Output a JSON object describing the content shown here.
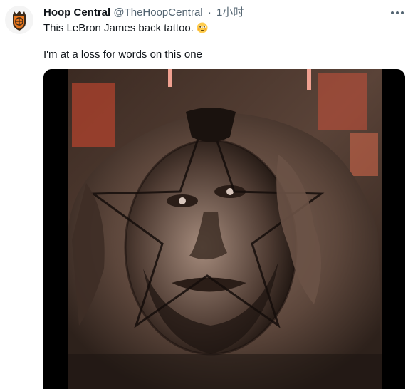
{
  "tweet": {
    "display_name": "Hoop Central",
    "handle": "@TheHoopCentral",
    "separator": "·",
    "time": "1小时",
    "text_line1": "This LeBron James back tattoo.",
    "text_line2": "I'm at a loss for words on this one",
    "emoji": "flushed-face-emoji"
  },
  "icons": {
    "more": "more-options-icon",
    "avatar": "hoop-central-logo-avatar"
  },
  "colors": {
    "text": "#0f1419",
    "secondary": "#536471",
    "logo_orange": "#e8771e",
    "logo_dark": "#3a2a1a"
  }
}
